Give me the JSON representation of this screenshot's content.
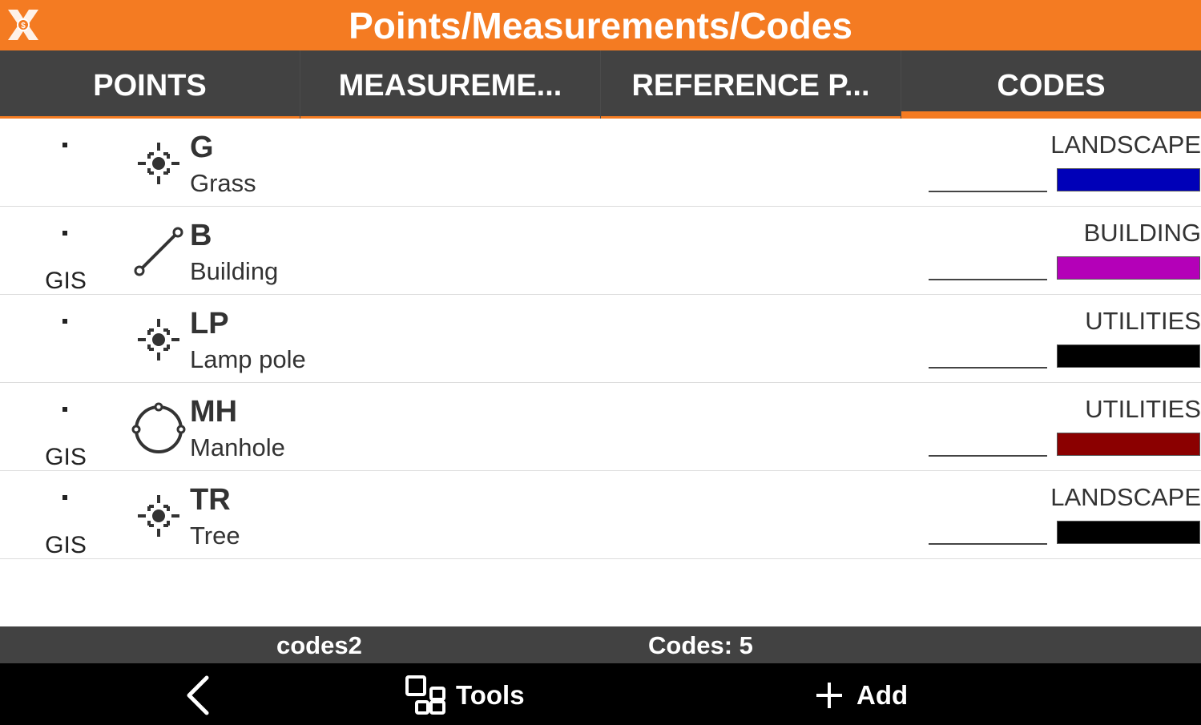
{
  "app": {
    "title": "Points/Measurements/Codes",
    "logo_icon": "app-logo-icon"
  },
  "tabs": [
    {
      "label": "POINTS",
      "active": false
    },
    {
      "label": "MEASUREME...",
      "active": false
    },
    {
      "label": "REFERENCE P...",
      "active": false
    },
    {
      "label": "CODES",
      "active": true
    }
  ],
  "codes": [
    {
      "marker": "·",
      "tag": "",
      "icon": "point-target-icon",
      "code": "G",
      "description": "Grass",
      "layer": "LANDSCAPE",
      "line": "__________",
      "color": "#0000b8"
    },
    {
      "marker": "·",
      "tag": "GIS",
      "icon": "line-segment-icon",
      "code": "B",
      "description": "Building",
      "layer": "BUILDING",
      "line": "__________",
      "color": "#b400b8"
    },
    {
      "marker": "·",
      "tag": "",
      "icon": "point-target-icon",
      "code": "LP",
      "description": "Lamp pole",
      "layer": "UTILITIES",
      "line": "__________",
      "color": "#000000"
    },
    {
      "marker": "·",
      "tag": "GIS",
      "icon": "circle-three-point-icon",
      "code": "MH",
      "description": "Manhole",
      "layer": "UTILITIES",
      "line": "__________",
      "color": "#8b0000"
    },
    {
      "marker": "·",
      "tag": "GIS",
      "icon": "point-target-icon",
      "code": "TR",
      "description": "Tree",
      "layer": "LANDSCAPE",
      "line": "__________",
      "color": "#000000"
    }
  ],
  "status": {
    "file": "codes2",
    "count": "Codes: 5"
  },
  "toolbar": {
    "back_icon": "chevron-left-icon",
    "tools_label": "Tools",
    "tools_icon": "grid-tools-icon",
    "add_label": "Add",
    "add_icon": "plus-icon"
  },
  "colors": {
    "accent": "#f47b22",
    "bar": "#424242",
    "bottom": "#000000"
  }
}
